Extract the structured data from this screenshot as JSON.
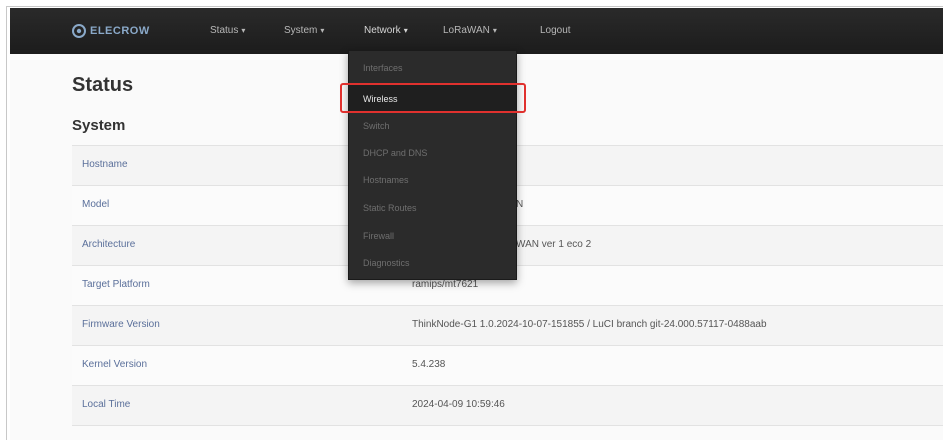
{
  "brand": {
    "name": "ELECROW"
  },
  "nav": {
    "items": [
      {
        "label": "Status",
        "caret": "▾"
      },
      {
        "label": "System",
        "caret": "▾"
      },
      {
        "label": "Network",
        "caret": "▾"
      },
      {
        "label": "LoRaWAN",
        "caret": "▾"
      },
      {
        "label": "Logout",
        "caret": ""
      }
    ]
  },
  "network_menu": {
    "items": [
      {
        "label": "Interfaces"
      },
      {
        "label": "Wireless"
      },
      {
        "label": "Switch"
      },
      {
        "label": "DHCP and DNS"
      },
      {
        "label": "Hostnames"
      },
      {
        "label": "Static Routes"
      },
      {
        "label": "Firewall"
      },
      {
        "label": "Diagnostics"
      }
    ],
    "selected": "Wireless"
  },
  "page": {
    "title": "Status",
    "section": "System"
  },
  "system_table": {
    "rows": [
      {
        "label": "Hostname",
        "value": ""
      },
      {
        "label": "Model",
        "value": "N"
      },
      {
        "label": "Architecture",
        "value": "WAN ver 1 eco 2"
      },
      {
        "label": "Target Platform",
        "value": "ramips/mt7621"
      },
      {
        "label": "Firmware Version",
        "value": "ThinkNode-G1 1.0.2024-10-07-151855 / LuCI branch git-24.000.57117-0488aab"
      },
      {
        "label": "Kernel Version",
        "value": "5.4.238"
      },
      {
        "label": "Local Time",
        "value": "2024-04-09 10:59:46"
      }
    ]
  },
  "colors": {
    "topbar": "#1c1c1c",
    "dropdown": "#2b2b2b",
    "highlight": "#e0312e",
    "label_link": "#5a6f9a"
  },
  "icons": {
    "brand": "elecrow-logo-icon",
    "caret": "chevron-down-icon"
  }
}
